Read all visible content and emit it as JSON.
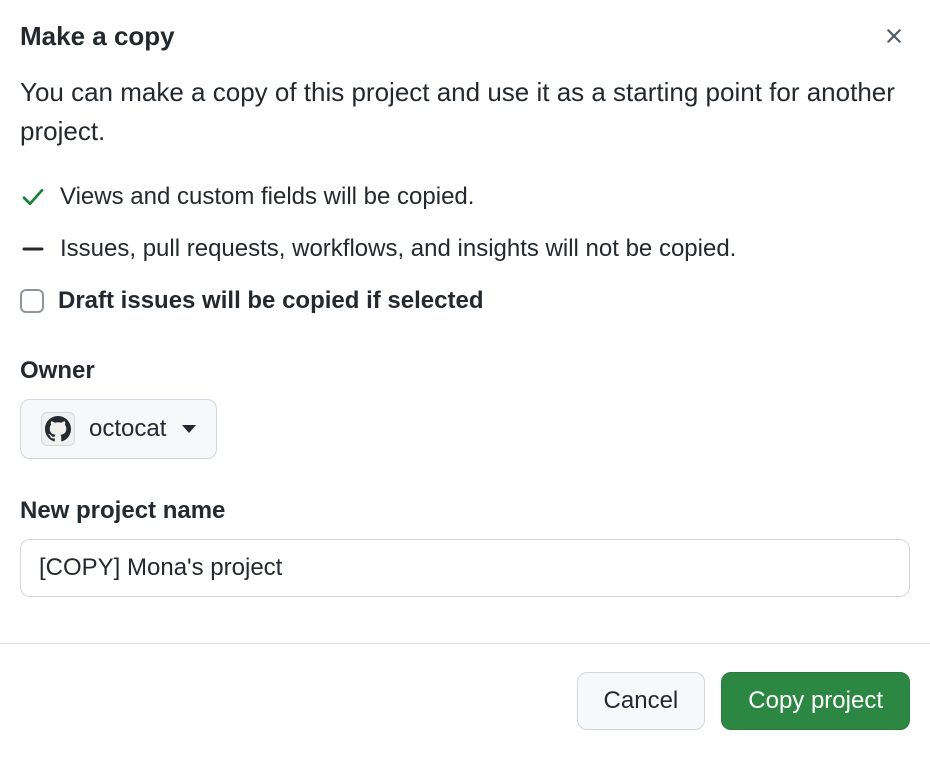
{
  "dialog": {
    "title": "Make a copy",
    "description": "You can make a copy of this project and use it as a starting point for another project.",
    "info_copied": "Views and custom fields will be copied.",
    "info_not_copied": "Issues, pull requests, workflows, and insights will not be copied.",
    "draft_checkbox_label": "Draft issues will be copied if selected"
  },
  "owner": {
    "label": "Owner",
    "selected": "octocat"
  },
  "name_field": {
    "label": "New project name",
    "value": "[COPY] Mona's project"
  },
  "actions": {
    "cancel": "Cancel",
    "submit": "Copy project"
  }
}
